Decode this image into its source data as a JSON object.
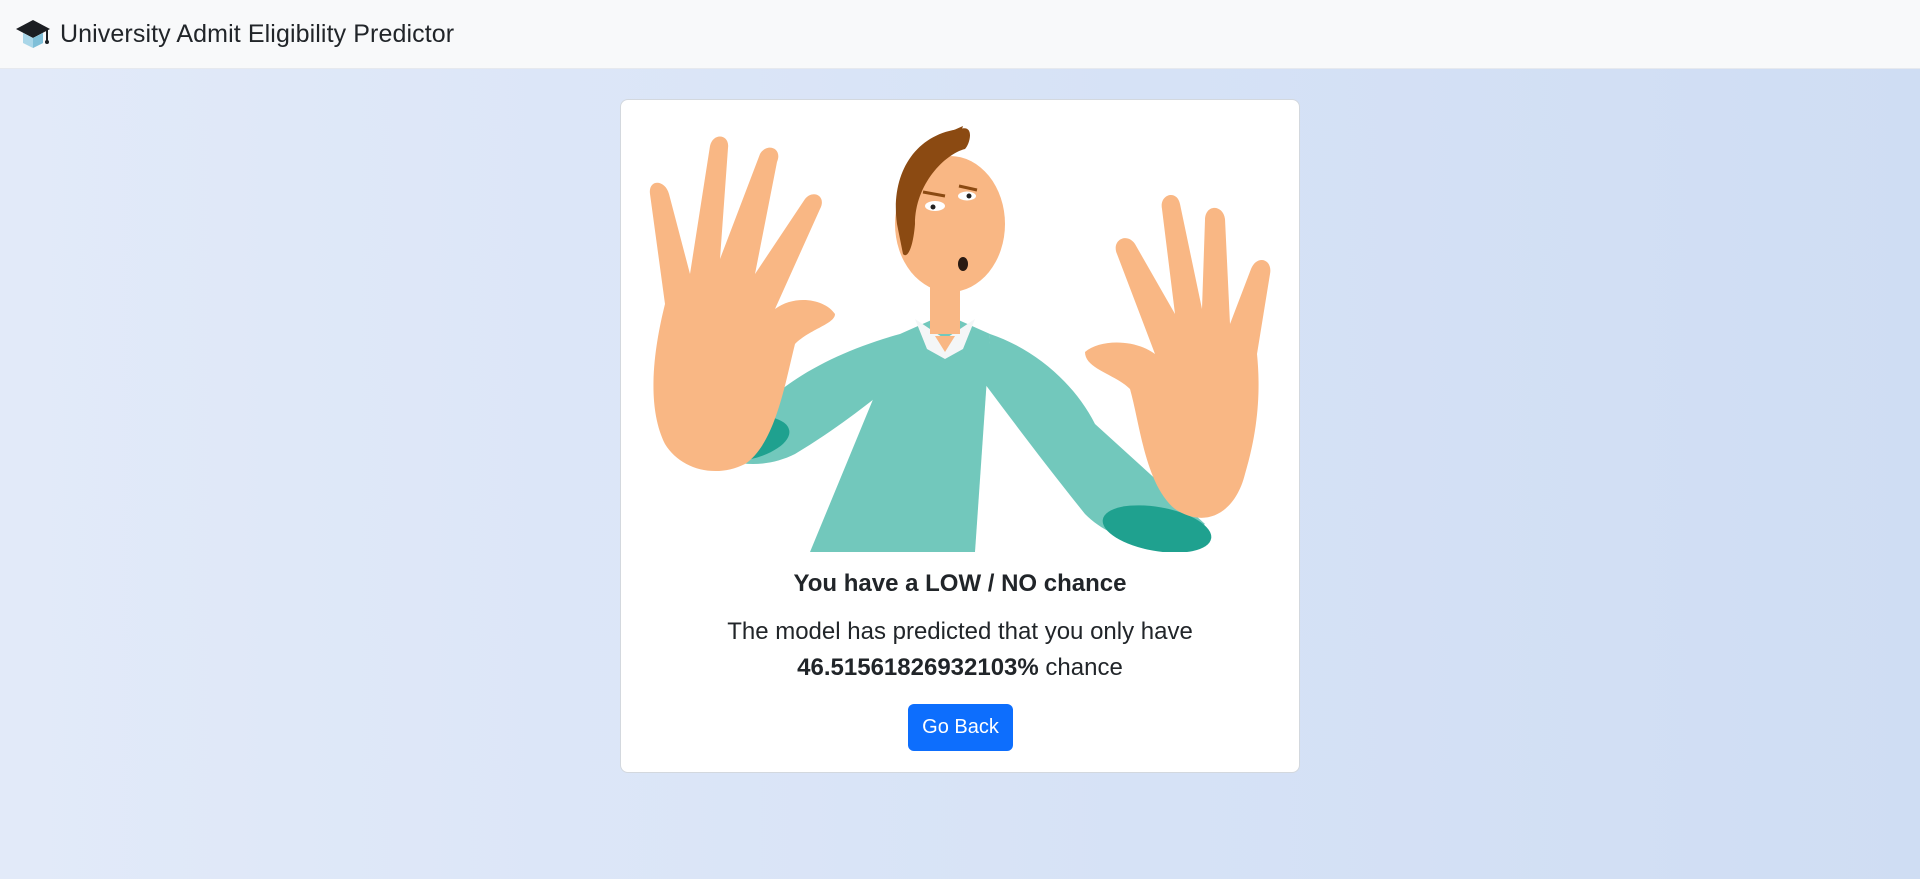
{
  "navbar": {
    "brand_icon": "graduation-cap-icon",
    "title": "University Admit Eligibility Predictor"
  },
  "result": {
    "title": "You have a LOW / NO chance",
    "message": "The model has predicted that you only have",
    "percentage": "46.51561826932103%",
    "suffix": " chance",
    "button_label": "Go Back"
  },
  "colors": {
    "button_primary": "#0d6efd",
    "skin": "#f9b784",
    "shirt": "#72c8bc",
    "cuff": "#1fa18f",
    "hair": "#8b4a12"
  }
}
